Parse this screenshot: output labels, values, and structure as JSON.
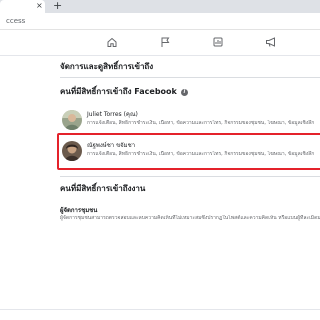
{
  "browser": {
    "close_glyph": "×",
    "new_tab_glyph": "+",
    "url": "ccess"
  },
  "navbar": {
    "icons": [
      "home-icon",
      "flag-icon",
      "page-icon",
      "chart-icon",
      "megaphone-icon"
    ]
  },
  "page": {
    "title": "จัดการและดูสิทธิ์การเข้าถึง",
    "facebook_section": {
      "title": "คนที่มีสิทธิ์การเข้าถึง Facebook",
      "info_glyph": "i",
      "people": [
        {
          "name": "Juliet Torres (คุณ)",
          "permissions": "การแจ้งเตือน, สิทธิ์การชำระเงิน, เนื้อหา, ข้อความและการโทร, กิจกรรมของชุมชน, โฆษณา, ข้อมูลเชิงลึก"
        },
        {
          "name": "ณัฐพงษ์ชา ขจัมชา",
          "permissions": "การแจ้งเตือน, สิทธิ์การชำระเงิน, เนื้อหา, ข้อความและการโทร, กิจกรรมของชุมชน, โฆษณา, ข้อมูลเชิงลึก"
        }
      ]
    },
    "task_section": {
      "title": "คนที่มีสิทธิ์การเข้าถึงงาน",
      "task_title": "ผู้จัดการชุมชน",
      "task_description": "ผู้จัดการชุมชนสามารถตรวจสอบและลบความคิดเห็นที่ไม่เหมาะสมซึ่งปรากฏในโพสต์และความคิดเห็น หรือแบนผู้ที่ละเมิดมาตรฐานชุมชนออก และดูข้อมูลเชิงลึกของผลงานเนื้อหาได้"
    }
  },
  "colors": {
    "highlight_border": "#e4222b",
    "secondary_text": "#65676b"
  }
}
